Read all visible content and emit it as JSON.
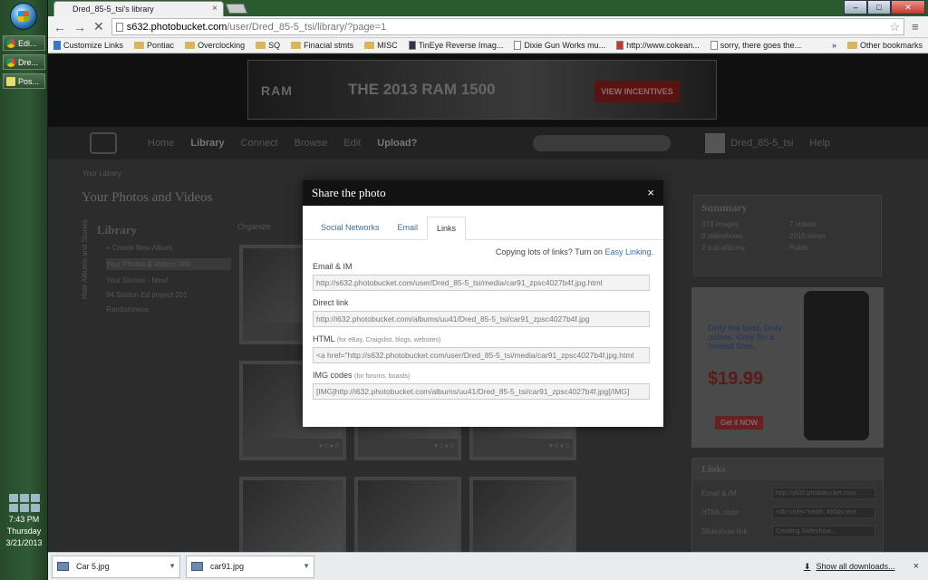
{
  "taskbar": {
    "buttons": [
      "Edi...",
      "Dre...",
      "Pos..."
    ],
    "clock": {
      "time": "7:43 PM",
      "day": "Thursday",
      "date": "3/21/2013"
    }
  },
  "browser": {
    "tab_title": "Dred_85-5_tsi's library",
    "url_host": "s632.photobucket.com",
    "url_path": "/user/Dred_85-5_tsi/library/?page=1",
    "bookmarks": [
      "Customize Links",
      "Pontiac",
      "Overclocking",
      "SQ",
      "Finacial stmts",
      "MISC",
      "TinEye Reverse Imag...",
      "Dixie Gun Works mu...",
      "http://www.cokean...",
      "sorry, there goes the..."
    ],
    "other_bookmarks": "Other bookmarks",
    "overflow": "»"
  },
  "page": {
    "ad": {
      "brand": "RAM",
      "headline": "THE 2013 RAM 1500",
      "cta": "VIEW INCENTIVES"
    },
    "nav": [
      "Home",
      "Library",
      "Connect",
      "Browse",
      "Edit",
      "Upload"
    ],
    "nav_help": "?",
    "user": "Dred_85-5_tsi",
    "help": "Help",
    "breadcrumb": "Your Library",
    "title": "Your Photos and Videos",
    "organize": "Organize",
    "sidebar": {
      "heading": "Library",
      "create": "+ Create New Album",
      "items": [
        "Your Photos & Videos  380",
        "Your Stories - New!",
        "84 Station Ed project   201",
        "Randomness"
      ],
      "vertical": "Hide Albums and Stories"
    },
    "summary": {
      "heading": "Summary",
      "stats": [
        "373 images",
        "7 videos",
        "0 slideshows",
        "2015 views",
        "2 sub-albums",
        "Public"
      ]
    },
    "side_ad": {
      "lines": "Only the best. Only online. Only for a limited time.",
      "price": "$19.99",
      "cta": "Get it NOW"
    },
    "links_panel": {
      "heading": "Links",
      "rows": [
        {
          "label": "Email & IM",
          "value": "http://s632.photobucket.com"
        },
        {
          "label": "HTML code",
          "value": "<div style=\"width: 480px;text"
        },
        {
          "label": "Slideshow link",
          "value": "Creating Slideshow..."
        }
      ]
    }
  },
  "modal": {
    "title": "Share the photo",
    "close": "×",
    "tabs": [
      "Social Networks",
      "Email",
      "Links"
    ],
    "active_tab": "Links",
    "hint_prefix": "Copying lots of links? Turn on",
    "hint_link": "Easy Linking.",
    "fields": [
      {
        "label": "Email & IM",
        "sub": "",
        "value": "http://s632.photobucket.com/user/Dred_85-5_tsi/media/car91_zpsc4027b4f.jpg.html"
      },
      {
        "label": "Direct link",
        "sub": "",
        "value": "http://i632.photobucket.com/albums/uu41/Dred_85-5_tsi/car91_zpsc4027b4f.jpg"
      },
      {
        "label": "HTML",
        "sub": "(for eBay, Craigslist, blogs, websites)",
        "value": "<a href=\"http://s632.photobucket.com/user/Dred_85-5_tsi/media/car91_zpsc4027b4f.jpg.html"
      },
      {
        "label": "IMG codes",
        "sub": "(for forums, boards)",
        "value": "[IMG]http://i632.photobucket.com/albums/uu41/Dred_85-5_tsi/car91_zpsc4027b4f.jpg[/IMG]"
      }
    ]
  },
  "downloads": {
    "items": [
      "Car 5.jpg",
      "car91.jpg"
    ],
    "show_all": "Show all downloads...",
    "close": "×"
  }
}
